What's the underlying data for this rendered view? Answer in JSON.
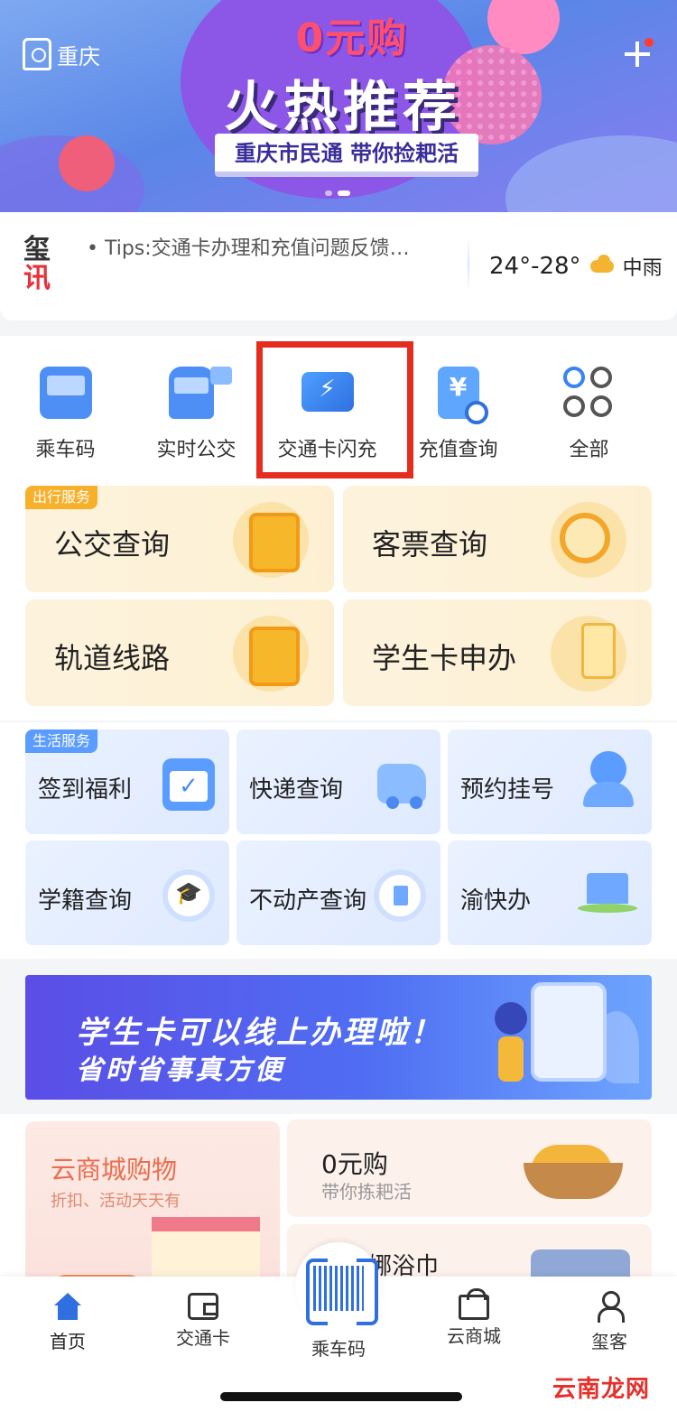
{
  "hero": {
    "city": "重庆",
    "headline_top": "0元购",
    "headline_main": "火热推荐",
    "tagline": "重庆市民通 带你捡耙活"
  },
  "news": {
    "logo_top": "玺",
    "logo_bottom": "讯",
    "tip": "• Tips:交通卡办理和充值问题反馈…",
    "temperature": "24°-28°",
    "condition": "中雨"
  },
  "quick_actions": [
    {
      "label": "乘车码",
      "icon": "bus-qr-icon"
    },
    {
      "label": "实时公交",
      "icon": "bus-stop-icon"
    },
    {
      "label": "交通卡闪充",
      "icon": "flash-card-icon"
    },
    {
      "label": "充值查询",
      "icon": "recharge-search-icon"
    },
    {
      "label": "全部",
      "icon": "grid-all-icon"
    }
  ],
  "travel": {
    "badge": "出行服务",
    "items": [
      {
        "label": "公交查询",
        "icon": "bus-icon"
      },
      {
        "label": "客票查询",
        "icon": "ticket-search-icon"
      },
      {
        "label": "轨道线路",
        "icon": "train-icon"
      },
      {
        "label": "学生卡申办",
        "icon": "student-card-icon"
      }
    ]
  },
  "life": {
    "badge": "生活服务",
    "items": [
      {
        "label": "签到福利",
        "icon": "calendar-check-icon"
      },
      {
        "label": "快递查询",
        "icon": "delivery-truck-icon"
      },
      {
        "label": "预约挂号",
        "icon": "doctor-icon"
      },
      {
        "label": "学籍查询",
        "icon": "graduation-search-icon"
      },
      {
        "label": "不动产查询",
        "icon": "building-search-icon"
      },
      {
        "label": "渝快办",
        "icon": "government-building-icon"
      }
    ]
  },
  "ad": {
    "line1": "学生卡可以线上办理啦！",
    "line2": "省时省事真方便"
  },
  "mall": {
    "left_title": "云商城购物",
    "left_subtitle": "折扣、活动天天有",
    "card1_title": "0元购",
    "card1_subtitle": "带你拣耙活",
    "card2_title": "娜浴巾"
  },
  "tabbar": [
    {
      "label": "首页",
      "icon": "home-icon",
      "active": true
    },
    {
      "label": "交通卡",
      "icon": "wallet-card-icon",
      "active": false
    },
    {
      "label": "乘车码",
      "icon": "scan-code-icon",
      "active": false
    },
    {
      "label": "云商城",
      "icon": "store-icon",
      "active": false
    },
    {
      "label": "玺客",
      "icon": "person-icon",
      "active": false
    }
  ],
  "watermark": "云南龙网",
  "colors": {
    "accent": "#2f6fe0",
    "highlight_box": "#e52d1f",
    "travel_badge": "#f7b02a",
    "life_badge": "#5a9cff"
  }
}
